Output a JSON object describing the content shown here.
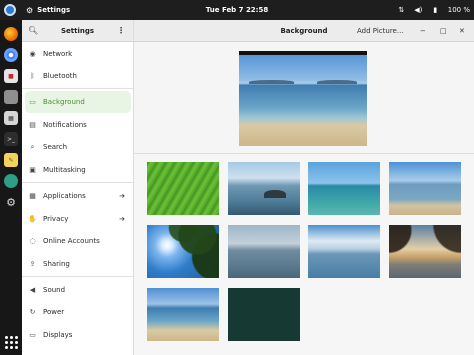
{
  "topbar": {
    "app_name": "Settings",
    "clock": "Tue Feb 7  22:58",
    "battery": "100 %"
  },
  "dock": {
    "items": [
      "firefox-icon",
      "chromium-icon",
      "files-icon",
      "archive-icon",
      "calculator-icon",
      "terminal-icon",
      "text-editor-icon",
      "software-icon",
      "settings-icon"
    ],
    "apps_grid": "show-apps-icon"
  },
  "sidebar": {
    "title": "Settings",
    "items": [
      {
        "label": "Network",
        "icon": "network-icon"
      },
      {
        "label": "Bluetooth",
        "icon": "bluetooth-icon"
      },
      {
        "label": "Background",
        "icon": "background-icon"
      },
      {
        "label": "Notifications",
        "icon": "notifications-icon"
      },
      {
        "label": "Search",
        "icon": "search-icon"
      },
      {
        "label": "Multitasking",
        "icon": "multitasking-icon"
      },
      {
        "label": "Applications",
        "icon": "applications-icon",
        "arrow": "›"
      },
      {
        "label": "Privacy",
        "icon": "privacy-icon",
        "arrow": "›"
      },
      {
        "label": "Online Accounts",
        "icon": "online-accounts-icon"
      },
      {
        "label": "Sharing",
        "icon": "sharing-icon"
      },
      {
        "label": "Sound",
        "icon": "sound-icon"
      },
      {
        "label": "Power",
        "icon": "power-icon"
      },
      {
        "label": "Displays",
        "icon": "displays-icon"
      }
    ],
    "active_index": 2
  },
  "main": {
    "title": "Background",
    "add_picture_label": "Add Picture..."
  },
  "wallpapers": [
    "green-leaf",
    "beach-rocks",
    "turquoise-sea",
    "calm-beach",
    "tree-sun",
    "grey-sea",
    "cloudy-sea",
    "sunset-branches",
    "beach-horizon",
    "dark-green-solid"
  ],
  "colors": {
    "accent": "#4a8d3a",
    "active_bg": "#e9f5e4"
  }
}
